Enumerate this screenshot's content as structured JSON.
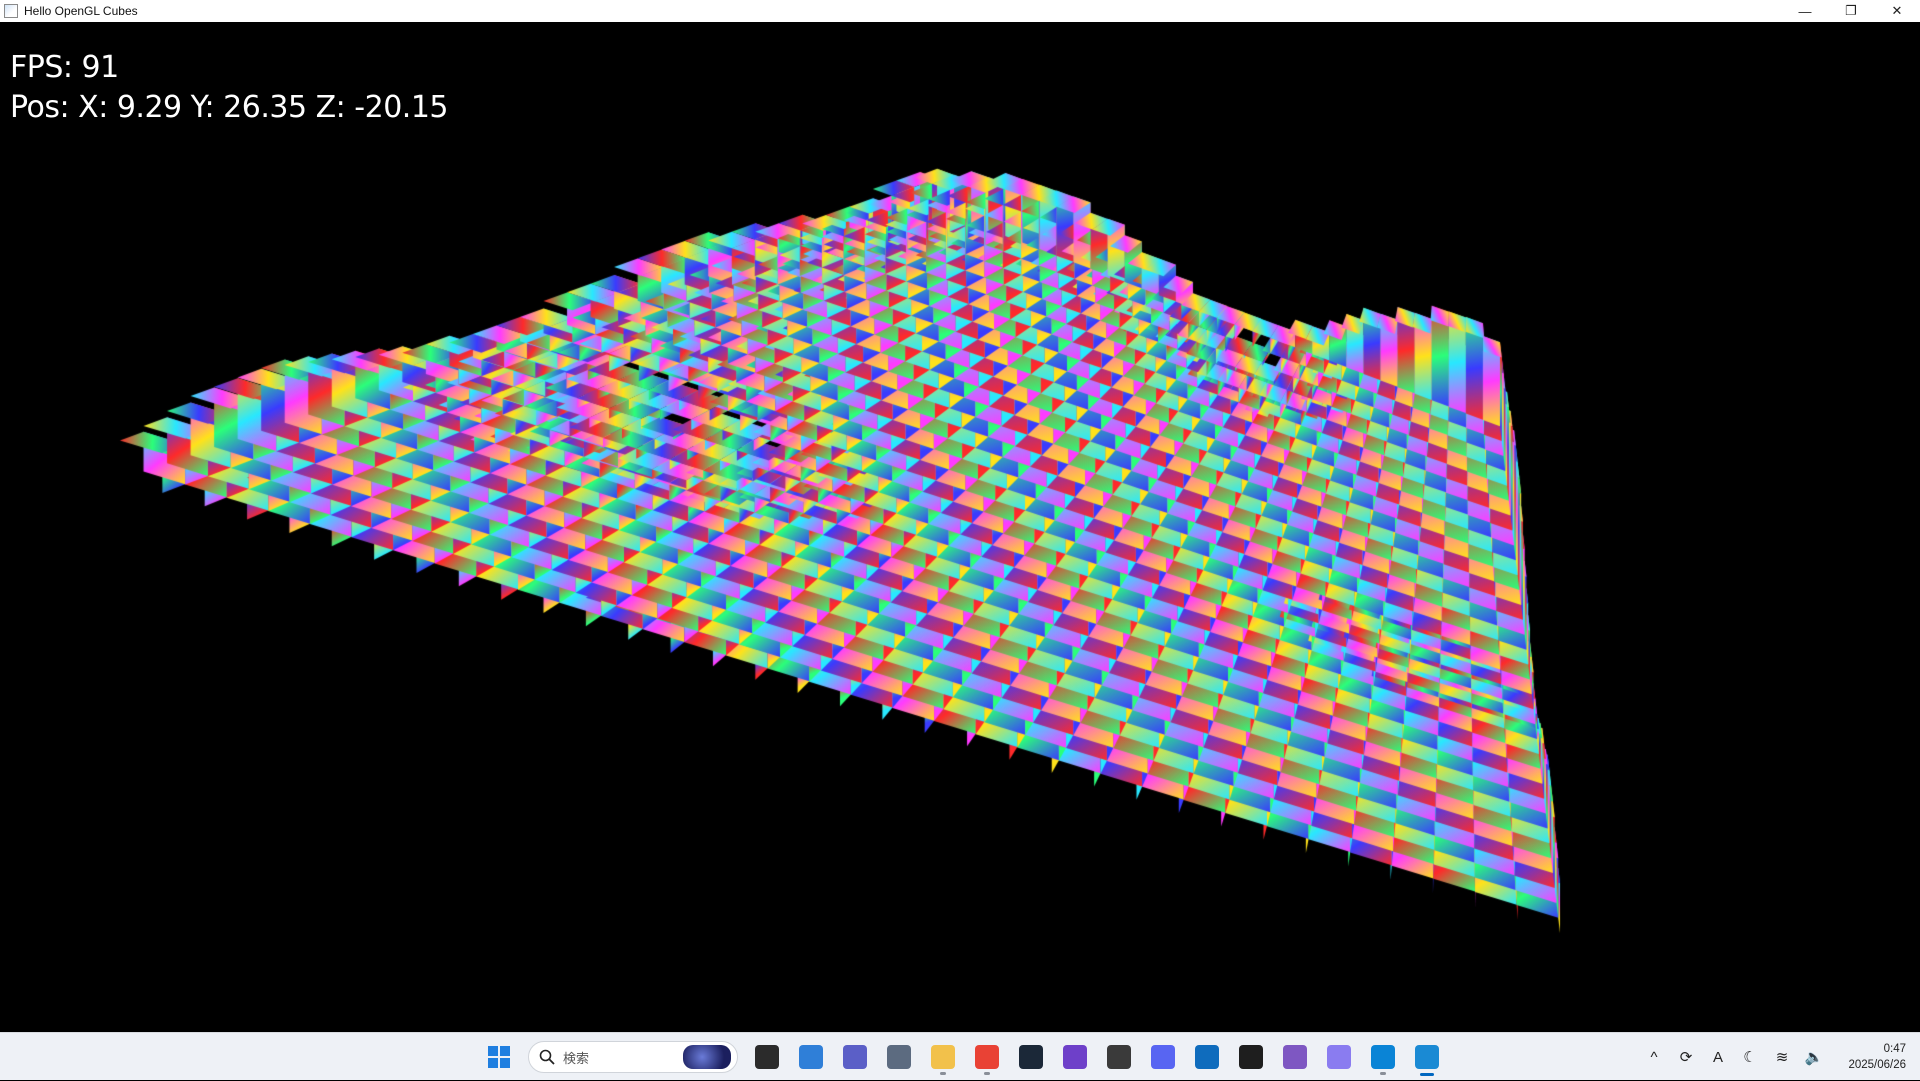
{
  "window": {
    "title": "Hello OpenGL Cubes",
    "minimize_glyph": "—",
    "maximize_glyph": "❐",
    "close_glyph": "✕"
  },
  "hud": {
    "fps": "FPS: 91",
    "pos": "Pos: X: 9.29 Y: 26.35 Z: -20.15"
  },
  "scene": {
    "description_colors": [
      "#ff2a2a",
      "#ffe21a",
      "#2bff7a",
      "#28e8ff",
      "#3a3bff",
      "#ff3bff"
    ],
    "background": "#000000"
  },
  "taskbar": {
    "search_placeholder": "検索",
    "apps": [
      {
        "name": "start",
        "icon": "windows-logo-icon",
        "color": "#1f7fe0"
      },
      {
        "name": "task-view",
        "icon": "task-view-icon",
        "color": "#2b2b2b"
      },
      {
        "name": "widgets",
        "icon": "widgets-icon",
        "color": "#2f7fd8"
      },
      {
        "name": "teams",
        "icon": "teams-icon",
        "color": "#5b5fc7"
      },
      {
        "name": "settings",
        "icon": "gear-icon",
        "color": "#5c6b80"
      },
      {
        "name": "file-explorer",
        "icon": "folder-icon",
        "color": "#f2c14b"
      },
      {
        "name": "chrome",
        "icon": "chrome-icon",
        "color": "#e94235"
      },
      {
        "name": "steam",
        "icon": "steam-icon",
        "color": "#1b2838"
      },
      {
        "name": "github",
        "icon": "github-icon",
        "color": "#6e40c9"
      },
      {
        "name": "unity",
        "icon": "unity-icon",
        "color": "#3a3a3a"
      },
      {
        "name": "discord",
        "icon": "discord-icon",
        "color": "#5865f2"
      },
      {
        "name": "outlook",
        "icon": "outlook-icon",
        "color": "#0f6cbd"
      },
      {
        "name": "terminal",
        "icon": "terminal-icon",
        "color": "#1e1e1e"
      },
      {
        "name": "visual-studio",
        "icon": "visual-studio-icon",
        "color": "#7e57c2"
      },
      {
        "name": "copilot",
        "icon": "copilot-icon",
        "color": "#8a7cf0"
      },
      {
        "name": "vscode",
        "icon": "vscode-icon",
        "color": "#0a84d6"
      },
      {
        "name": "opengl-app",
        "icon": "app-window-icon",
        "color": "#1a8ad4"
      }
    ],
    "tray": {
      "chevron": "^",
      "sync": "⟳",
      "ime": "A",
      "moon": "☾",
      "wifi": "≋",
      "volume": "🔈",
      "time": "0:47",
      "date": "2025/06/26"
    }
  }
}
